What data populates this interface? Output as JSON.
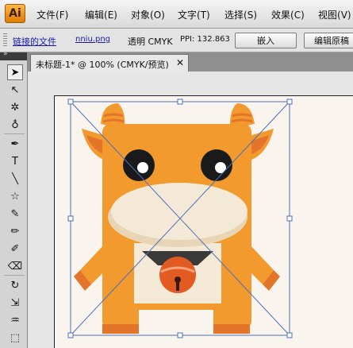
{
  "app": {
    "logo": "Ai"
  },
  "menu": [
    {
      "label": "文件",
      "key": "(F)"
    },
    {
      "label": "编辑",
      "key": "(E)"
    },
    {
      "label": "对象",
      "key": "(O)"
    },
    {
      "label": "文字",
      "key": "(T)"
    },
    {
      "label": "选择",
      "key": "(S)"
    },
    {
      "label": "效果",
      "key": "(C)"
    },
    {
      "label": "视图",
      "key": "(V)"
    }
  ],
  "control": {
    "linked_file_label": "链接的文件",
    "file_name": "nniu.png",
    "transparency": "透明 CMYK",
    "ppi": "PPI: 132.863",
    "embed_button": "嵌入",
    "edit_original_button": "编辑原稿"
  },
  "toolbox": {
    "collapse": "»",
    "tools": [
      {
        "name": "selection-tool-icon",
        "glyph": "➤",
        "active": true
      },
      {
        "name": "direct-selection-tool-icon",
        "glyph": "↖",
        "active": false
      },
      {
        "name": "magic-wand-tool-icon",
        "glyph": "✲",
        "active": false
      },
      {
        "name": "lasso-tool-icon",
        "glyph": "♁",
        "active": false
      },
      {
        "name": "pen-tool-icon",
        "glyph": "✒",
        "active": false
      },
      {
        "name": "type-tool-icon",
        "glyph": "T",
        "active": false
      },
      {
        "name": "line-tool-icon",
        "glyph": "╲",
        "active": false
      },
      {
        "name": "star-tool-icon",
        "glyph": "☆",
        "active": false
      },
      {
        "name": "paintbrush-tool-icon",
        "glyph": "✎",
        "active": false
      },
      {
        "name": "pencil-tool-icon",
        "glyph": "✏",
        "active": false
      },
      {
        "name": "blob-brush-tool-icon",
        "glyph": "✐",
        "active": false
      },
      {
        "name": "eraser-tool-icon",
        "glyph": "⌫",
        "active": false
      },
      {
        "name": "rotate-tool-icon",
        "glyph": "↻",
        "active": false
      },
      {
        "name": "scale-tool-icon",
        "glyph": "⇲",
        "active": false
      },
      {
        "name": "warp-tool-icon",
        "glyph": "♒",
        "active": false
      },
      {
        "name": "free-transform-tool-icon",
        "glyph": "⬚",
        "active": false
      }
    ]
  },
  "document_tab": {
    "title": "未标题-1* @ 100% (CMYK/预览)",
    "close": "✕"
  },
  "colors": {
    "body_orange": "#f39a2e",
    "dark_orange": "#e3742a",
    "cream": "#f4e9d6",
    "bell": "#e25b23",
    "selection_blue": "#4d6fb8"
  }
}
